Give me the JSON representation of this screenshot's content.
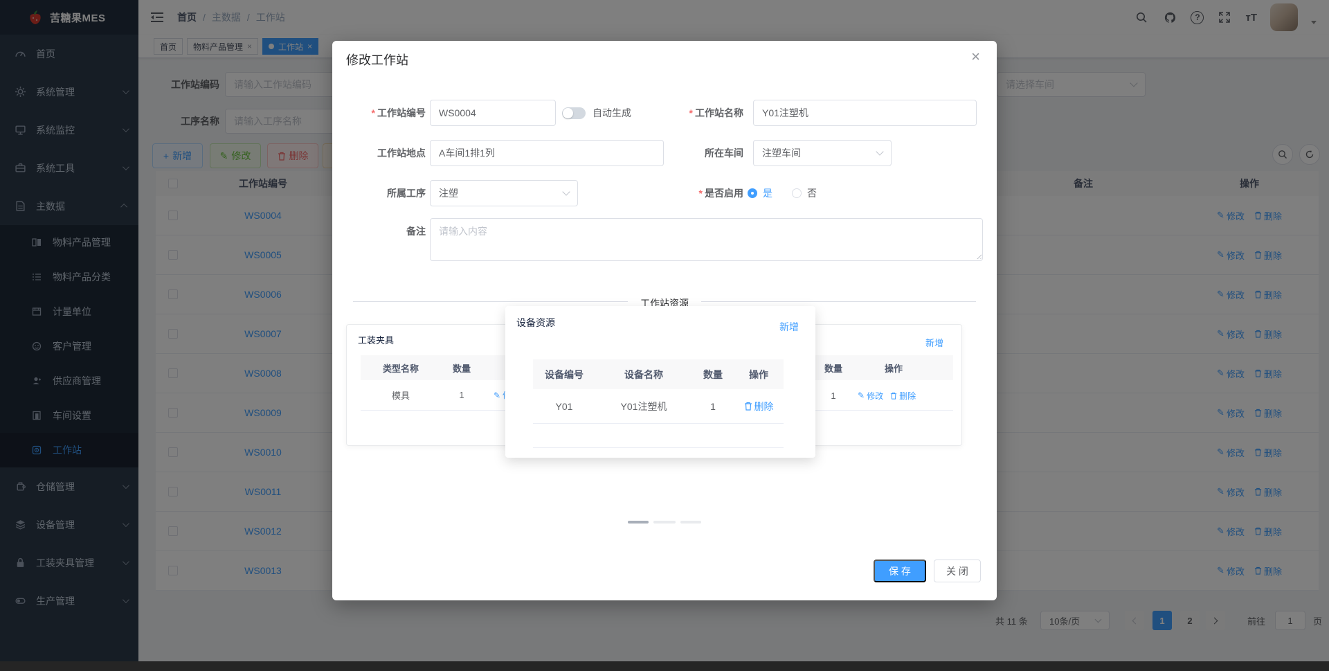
{
  "app_title": "苦糖果MES",
  "required_mark": "*",
  "icons": {
    "close": "×",
    "pen": "✎",
    "plus": "+",
    "question": "?"
  },
  "navbar": {
    "breadcrumb": [
      "首页",
      "主数据",
      "工作站"
    ],
    "separator": "/",
    "font_size_glyph": "тT"
  },
  "tabs": [
    {
      "label": "首页"
    },
    {
      "label": "物料产品管理"
    },
    {
      "label": "工作站"
    }
  ],
  "sidebar": {
    "items_top": [
      {
        "label": "首页"
      },
      {
        "label": "系统管理"
      },
      {
        "label": "系统监控"
      },
      {
        "label": "系统工具"
      },
      {
        "label": "主数据"
      }
    ],
    "submenu": [
      {
        "label": "物料产品管理"
      },
      {
        "label": "物料产品分类"
      },
      {
        "label": "计量单位"
      },
      {
        "label": "客户管理"
      },
      {
        "label": "供应商管理"
      },
      {
        "label": "车间设置"
      },
      {
        "label": "工作站"
      }
    ],
    "items_bottom": [
      {
        "label": "仓储管理"
      },
      {
        "label": "设备管理"
      },
      {
        "label": "工装夹具管理"
      },
      {
        "label": "生产管理"
      }
    ]
  },
  "filters": {
    "code_label": "工作站编码",
    "code_placeholder": "请输入工作站编码",
    "process_label": "工序名称",
    "process_placeholder": "请输入工序名称",
    "workshop_placeholder": "请选择车间"
  },
  "toolbar": {
    "add": "新增",
    "edit": "修改",
    "delete": "删除"
  },
  "grid": {
    "header_code": "工作站编号",
    "header_remark": "备注",
    "header_action": "操作",
    "action_edit": "修改",
    "action_delete": "删除",
    "rows": [
      "WS0004",
      "WS0005",
      "WS0006",
      "WS0007",
      "WS0008",
      "WS0009",
      "WS0010",
      "WS0011",
      "WS0012",
      "WS0013"
    ]
  },
  "pagination": {
    "total": "共 11 条",
    "page_size": "10条/页",
    "page1": "1",
    "page2": "2",
    "goto": "前往",
    "goto_value": "1",
    "unit": "页"
  },
  "dialog": {
    "title": "修改工作站",
    "code_label": "工作站编号",
    "code_value": "WS0004",
    "auto_label": "自动生成",
    "name_label": "工作站名称",
    "name_value": "Y01注塑机",
    "location_label": "工作站地点",
    "location_value": "A车间1排1列",
    "workshop_label": "所在车间",
    "workshop_value": "注塑车间",
    "process_label": "所属工序",
    "process_value": "注塑",
    "enabled_label": "是否启用",
    "enabled_yes": "是",
    "enabled_no": "否",
    "remark_label": "备注",
    "remark_placeholder": "请输入内容",
    "divider": "工作站资源",
    "fixture_card": {
      "title": "工装夹具",
      "h_type": "类型名称",
      "h_qty": "数量",
      "row_type": "模具",
      "row_qty": "1",
      "action_edit": "修改"
    },
    "device_card": {
      "title": "设备资源",
      "add": "新增",
      "h_code": "设备编号",
      "h_name": "设备名称",
      "h_qty": "数量",
      "h_action": "操作",
      "row_code": "Y01",
      "row_name": "Y01注塑机",
      "row_qty": "1",
      "action_delete": "删除"
    },
    "right_card": {
      "add": "新增",
      "h_qty": "数量",
      "h_action": "操作",
      "row_qty": "1",
      "action_edit": "修改",
      "action_delete": "删除"
    },
    "save": "保 存",
    "close": "关 闭"
  }
}
